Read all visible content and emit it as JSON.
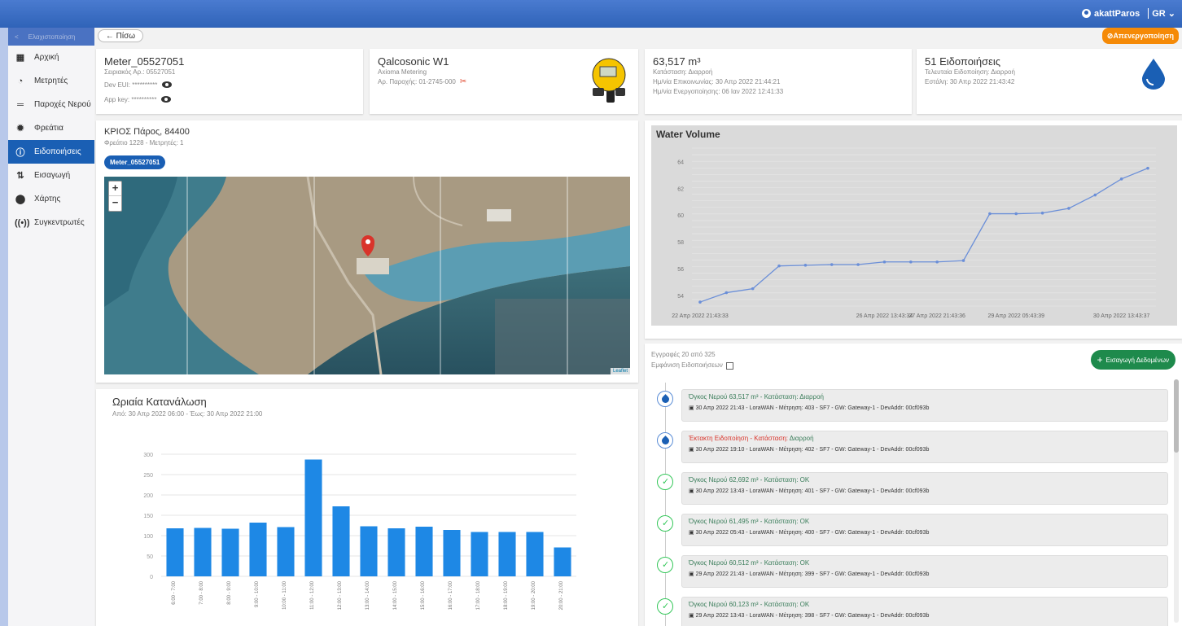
{
  "header": {
    "user": "akattParos",
    "lang": "GR"
  },
  "sidebar": {
    "minimize": "Ελαχιστοποίηση",
    "items": [
      {
        "label": "Αρχική",
        "icon": "grid-icon"
      },
      {
        "label": "Μετρητές",
        "icon": "gauge-icon"
      },
      {
        "label": "Παροχές Νερού",
        "icon": "pipe-icon"
      },
      {
        "label": "Φρεάτια",
        "icon": "valve-icon"
      },
      {
        "label": "Ειδοποιήσεις",
        "icon": "alert-icon",
        "active": true
      },
      {
        "label": "Εισαγωγή",
        "icon": "import-icon"
      },
      {
        "label": "Χάρτης",
        "icon": "pin-icon"
      },
      {
        "label": "Συγκεντρωτές",
        "icon": "antenna-icon"
      }
    ]
  },
  "toolbar": {
    "back": "Πίσω",
    "deactivate": "Απενεργοποίηση"
  },
  "meter": {
    "name": "Meter_05527051",
    "serial": "Σειριακός Αρ.: 05527051",
    "dev_eui": "Dev EUI: **********",
    "app_key": "App key: **********"
  },
  "device": {
    "model": "Qalcosonic W1",
    "maker": "Axioma Metering",
    "supply": "Αρ. Παροχής: 01-2745-000"
  },
  "status": {
    "volume": "63,517 m³",
    "state": "Κατάσταση: Διαρροή",
    "last_comm": "Ημ/νία Επικοινωνίας: 30 Απρ 2022 21:44:21",
    "activation": "Ημ/νία Ενεργοποίησης: 06 Ιαν 2022 12:41:33"
  },
  "notifications": {
    "count": "51 Ειδοποιήσεις",
    "last": "Τελευταία Ειδοποίηση: Διαρροή",
    "sent": "Εστάλη: 30 Απρ 2022 21:43:42"
  },
  "location": {
    "title": "ΚΡΙΟΣ Πάρος, 84400",
    "sub": "Φρεάτιο 1228 - Μετρητές: 1",
    "chip": "Meter_05527051",
    "zoom_in": "+",
    "zoom_out": "−",
    "attribution": "Leaflet"
  },
  "hourly": {
    "title": "Ωριαία Κατανάλωση",
    "range": "Από: 30 Απρ 2022 06:00 - Έως: 30 Απρ 2022 21:00"
  },
  "volume_chart": {
    "title": "Water Volume"
  },
  "events": {
    "count": "Εγγραφές 20 από 325",
    "show_notifications": "Εμφάνιση Ειδοποιήσεων",
    "add_button": "Εισαγωγή Δεδομένων",
    "items": [
      {
        "head": "Όγκος Νερού 63,517 m³ - Κατάσταση:",
        "state": "Διαρροή",
        "head_color": "#3a7d5a",
        "detail": "30 Απρ 2022 21:43 - LoraWAN - Μέτρηση: 403 - SF7 - GW: Gateway-1 - DevAddr: 00cf093b",
        "kind": "leak"
      },
      {
        "head": "Έκτακτη Ειδοποίηση - Κατάσταση:",
        "state": "Διαρροή",
        "head_color": "#d9342b",
        "detail": "30 Απρ 2022 19:10 - LoraWAN - Μέτρηση: 402 - SF7 - GW: Gateway-1 - DevAddr: 00cf093b",
        "kind": "leak"
      },
      {
        "head": "Όγκος Νερού 62,692 m³ - Κατάσταση:",
        "state": "OK",
        "head_color": "#3a7d5a",
        "detail": "30 Απρ 2022 13:43 - LoraWAN - Μέτρηση: 401 - SF7 - GW: Gateway-1 - DevAddr: 00cf093b",
        "kind": "ok"
      },
      {
        "head": "Όγκος Νερού 61,495 m³ - Κατάσταση:",
        "state": "OK",
        "head_color": "#3a7d5a",
        "detail": "30 Απρ 2022 05:43 - LoraWAN - Μέτρηση: 400 - SF7 - GW: Gateway-1 - DevAddr: 00cf093b",
        "kind": "ok"
      },
      {
        "head": "Όγκος Νερού 60,512 m³ - Κατάσταση:",
        "state": "OK",
        "head_color": "#3a7d5a",
        "detail": "29 Απρ 2022 21:43 - LoraWAN - Μέτρηση: 399 - SF7 - GW: Gateway-1 - DevAddr: 00cf093b",
        "kind": "ok"
      },
      {
        "head": "Όγκος Νερού 60,123 m³ - Κατάσταση:",
        "state": "OK",
        "head_color": "#3a7d5a",
        "detail": "29 Απρ 2022 13:43 - LoraWAN - Μέτρηση: 398 - SF7 - GW: Gateway-1 - DevAddr: 00cf093b",
        "kind": "ok"
      }
    ]
  },
  "chart_data": [
    {
      "type": "bar",
      "title": "Ωριαία Κατανάλωση",
      "categories": [
        "6:00 - 7:00",
        "7:00 - 8:00",
        "8:00 - 9:00",
        "9:00 - 10:00",
        "10:00 - 11:00",
        "11:00 - 12:00",
        "12:00 - 13:00",
        "13:00 - 14:00",
        "14:00 - 15:00",
        "15:00 - 16:00",
        "16:00 - 17:00",
        "17:00 - 18:00",
        "18:00 - 19:00",
        "19:00 - 20:00",
        "20:00 - 21:00"
      ],
      "values": [
        118,
        119,
        117,
        132,
        121,
        287,
        172,
        123,
        118,
        122,
        114,
        109,
        109,
        109,
        71
      ],
      "ylim": [
        0,
        300
      ],
      "yticks": [
        0,
        50,
        100,
        150,
        200,
        250,
        300
      ],
      "color": "#1e88e5",
      "grid": true
    },
    {
      "type": "line",
      "title": "Water Volume",
      "x": [
        "22 Απρ 2022 21:43:33",
        "23 Απρ",
        "23 Απρ",
        "24 Απρ",
        "25 Απρ",
        "25 Απρ",
        "26 Απρ",
        "26 Απρ 2022 13:43:34",
        "27 Απρ",
        "27 Απρ 2022 21:43:36",
        "28 Απρ",
        "28 Απρ",
        "29 Απρ 2022 05:43:39",
        "29 Απρ",
        "29 Απρ",
        "30 Απρ",
        "30 Απρ 2022 13:43:37",
        "30 Απρ"
      ],
      "values": [
        53.5,
        54.2,
        54.5,
        56.2,
        56.25,
        56.3,
        56.3,
        56.5,
        56.5,
        56.5,
        56.6,
        60.1,
        60.1,
        60.15,
        60.5,
        61.5,
        62.7,
        63.5
      ],
      "xticks": [
        "22 Απρ 2022 21:43:33",
        "26 Απρ 2022 13:43:34",
        "27 Απρ 2022 21:43:36",
        "29 Απρ 2022 05:43:39",
        "30 Απρ 2022 13:43:37"
      ],
      "yticks": [
        54,
        56,
        58,
        60,
        62,
        64
      ],
      "ylim": [
        53.2,
        65
      ],
      "color": "#6b8fd8",
      "grid": true
    }
  ]
}
